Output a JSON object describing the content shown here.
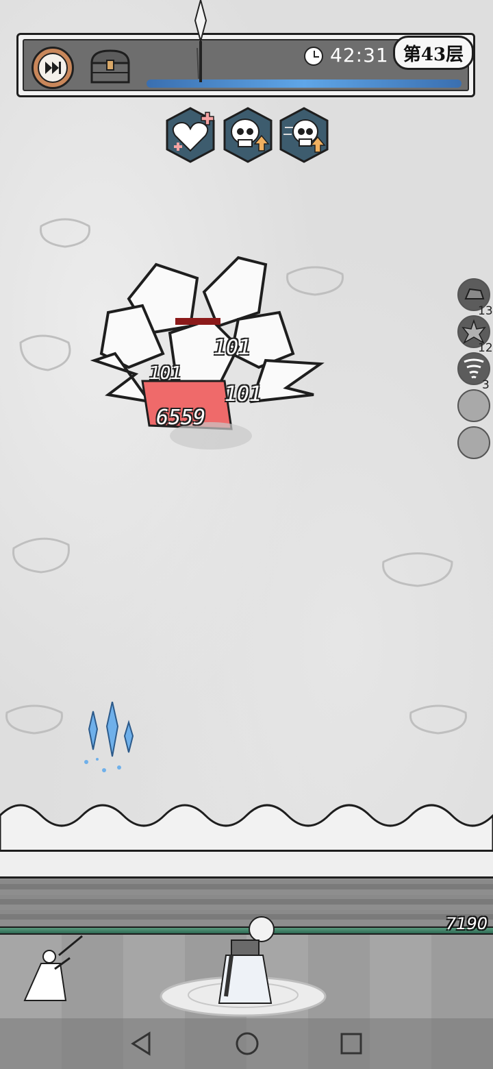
{
  "hud": {
    "timer": "42:31",
    "floor_label": "第43层",
    "fast_forward_icon": "fast-forward-icon",
    "chest_icon": "treasure-chest-icon",
    "clock_icon": "clock-icon"
  },
  "buffs": [
    {
      "icon": "heart-plus-icon"
    },
    {
      "icon": "skull-attack-up-icon"
    },
    {
      "icon": "skull-speed-up-icon"
    }
  ],
  "skills": [
    {
      "icon": "rock-skill-icon",
      "count": "13"
    },
    {
      "icon": "spiky-skill-icon",
      "count": "12"
    },
    {
      "icon": "tornado-skill-icon",
      "count": "3"
    },
    {
      "icon": "empty-slot-icon",
      "count": ""
    },
    {
      "icon": "empty-slot-icon",
      "count": ""
    }
  ],
  "combat": {
    "damage_numbers": [
      "101",
      "101",
      "101",
      "6559"
    ],
    "player_hp": "7190"
  },
  "colors": {
    "hud_panel": "#6e6e6e",
    "hp_bar": "#2f6b55",
    "enemy_hp": "#8b1a1a",
    "ice_crystal": "#5fa6e8"
  },
  "navigation": {
    "back": "back-icon",
    "home": "home-icon",
    "recent": "recent-apps-icon"
  }
}
